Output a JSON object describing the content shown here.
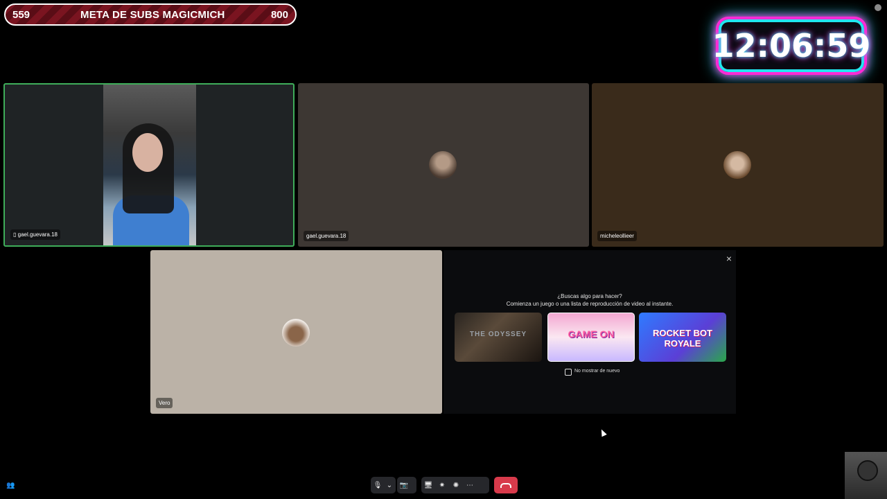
{
  "overlay": {
    "sub_current": "559",
    "sub_title": "META DE SUBS MAGICMICH",
    "sub_goal": "800",
    "clock": "12:06:59"
  },
  "tiles": [
    {
      "name": "gael.guevara.18",
      "device_icon": "phone-icon"
    },
    {
      "name": "gael.guevara.18"
    },
    {
      "name": "micheleollieer"
    },
    {
      "name": "Vero"
    }
  ],
  "activity": {
    "close_label": "×",
    "question": "¿Buscas algo para hacer?",
    "subtitle": "Comienza un juego o una lista de reproducción de video al instante.",
    "cards": [
      "THE ODYSSEY",
      "GAME ON",
      "ROCKET BOT ROYALE"
    ],
    "checkbox_label": "No mostrar de nuevo"
  },
  "toolbar": {
    "mic": "🎙",
    "dropdown": "⌄",
    "camera": "📷",
    "share": "🖥",
    "activities": "✷",
    "soundboard": "✺",
    "more": "⋯"
  },
  "colors": {
    "speaking_border": "#3fae5a",
    "leave_red": "#d83a4b",
    "clock_pink": "#ff2bd6",
    "clock_cyan": "#21e6f0"
  }
}
